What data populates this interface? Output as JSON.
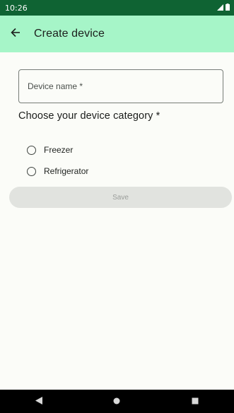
{
  "status_bar": {
    "time": "10:26",
    "icons": [
      "signal-icon",
      "battery-icon"
    ]
  },
  "app_bar": {
    "back_icon": "arrow-left-icon",
    "title": "Create device"
  },
  "form": {
    "device_name": {
      "placeholder": "Device name *",
      "value": ""
    },
    "category_title": "Choose your device category *",
    "category_options": [
      {
        "label": "Freezer",
        "selected": false
      },
      {
        "label": "Refrigerator",
        "selected": false
      }
    ],
    "save_label": "Save",
    "save_enabled": false
  },
  "nav_bar": {
    "buttons": [
      "back-triangle-icon",
      "home-circle-icon",
      "recents-square-icon"
    ]
  },
  "colors": {
    "status_bar": "#0f6333",
    "app_bar": "#a6f5c8",
    "background": "#fbfcf8",
    "save_disabled_bg": "#e1e3df"
  }
}
